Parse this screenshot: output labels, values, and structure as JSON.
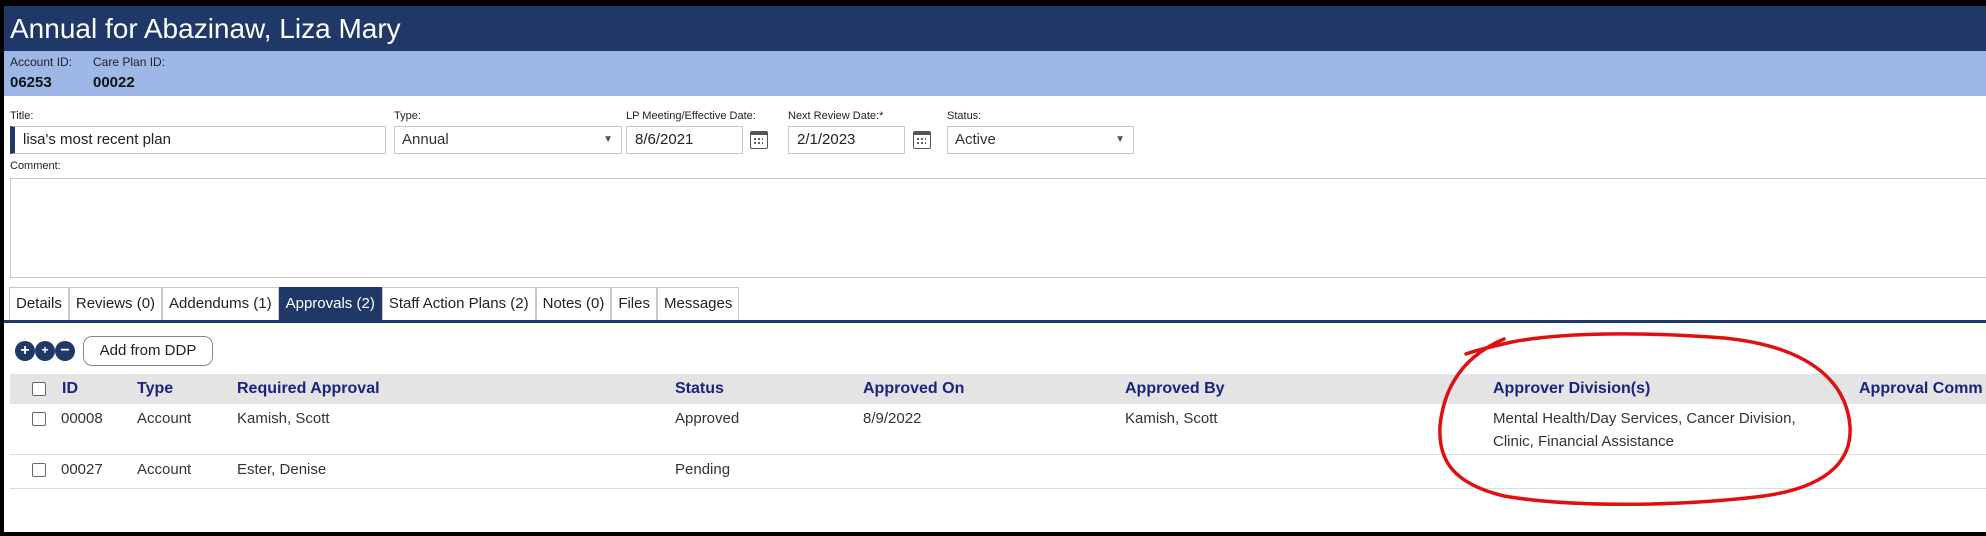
{
  "header": {
    "title": "Annual for Abazinaw, Liza Mary"
  },
  "ids": {
    "account_label": "Account ID:",
    "account_value": "06253",
    "careplan_label": "Care Plan ID:",
    "careplan_value": "00022"
  },
  "form": {
    "title_label": "Title:",
    "title_value": "lisa's most recent plan",
    "type_label": "Type:",
    "type_value": "Annual",
    "lp_label": "LP Meeting/Effective Date:",
    "lp_value": "8/6/2021",
    "next_label": "Next Review Date:*",
    "next_value": "2/1/2023",
    "status_label": "Status:",
    "status_value": "Active",
    "comment_label": "Comment:"
  },
  "tabs": [
    {
      "label": "Details"
    },
    {
      "label": "Reviews (0)"
    },
    {
      "label": "Addendums (1)"
    },
    {
      "label": "Approvals (2)"
    },
    {
      "label": "Staff Action Plans (2)"
    },
    {
      "label": "Notes (0)"
    },
    {
      "label": "Files"
    },
    {
      "label": "Messages"
    }
  ],
  "toolbar": {
    "add_from_ddp": "Add from DDP"
  },
  "table": {
    "headers": {
      "id": "ID",
      "type": "Type",
      "required": "Required Approval",
      "status": "Status",
      "approved_on": "Approved On",
      "approved_by": "Approved By",
      "division": "Approver Division(s)",
      "comment": "Approval Comm"
    },
    "rows": [
      {
        "id": "00008",
        "type": "Account",
        "required": "Kamish, Scott",
        "status": "Approved",
        "approved_on": "8/9/2022",
        "approved_by": "Kamish, Scott",
        "division": "Mental Health/Day Services, Cancer Division, Clinic, Financial Assistance"
      },
      {
        "id": "00027",
        "type": "Account",
        "required": "Ester, Denise",
        "status": "Pending",
        "approved_on": "",
        "approved_by": "",
        "division": ""
      }
    ]
  },
  "colors": {
    "header_bg": "#1f3868",
    "idbar_bg": "#9db7e6",
    "annotation": "#e01010"
  }
}
